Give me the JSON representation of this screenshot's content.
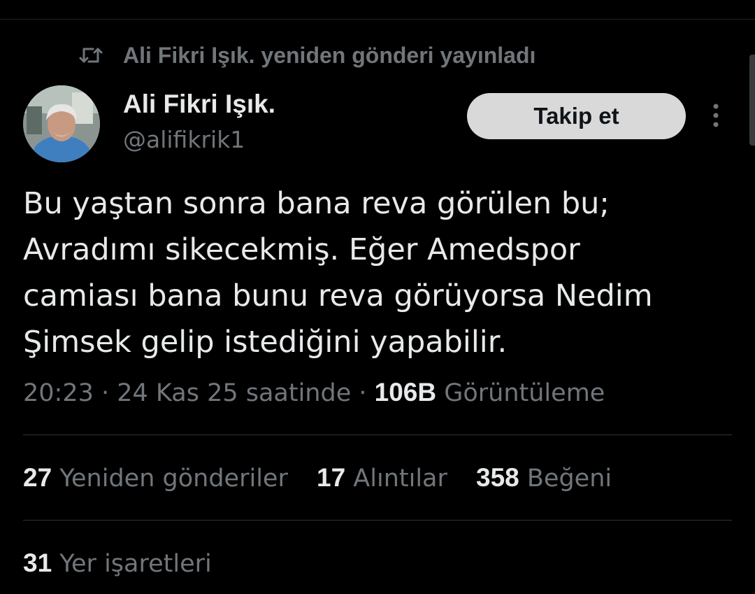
{
  "repost": {
    "icon": "repost-icon",
    "text": "Ali Fikri Işık. yeniden gönderi yayınladı"
  },
  "author": {
    "avatar": "avatar",
    "name": "Ali Fikri Işık.",
    "handle": "@alifikrik1"
  },
  "actions": {
    "follow_label": "Takip et",
    "more_icon": "more-vertical-icon"
  },
  "tweet": {
    "lines": [
      "Bu yaştan sonra bana reva görülen bu;",
      "Avradımı sikecekmiş. Eğer Amedspor",
      "camiası bana bunu reva görüyorsa Nedim",
      "Şimsek gelip istediğini yapabilir."
    ]
  },
  "meta": {
    "time": "20:23",
    "separator": " · ",
    "date": "24 Kas 25 saatinde",
    "views_count": "106B",
    "views_label": "Görüntüleme"
  },
  "stats": {
    "reposts_count": "27",
    "reposts_label": "Yeniden gönderiler",
    "quotes_count": "17",
    "quotes_label": "Alıntılar",
    "likes_count": "358",
    "likes_label": "Beğeni",
    "bookmarks_count": "31",
    "bookmarks_label": "Yer işaretleri"
  },
  "colors": {
    "background": "#000000",
    "primary_text": "#e7e9ea",
    "secondary_text": "#71767b",
    "follow_button_bg": "#d9d9d9",
    "divider": "#2f3336"
  }
}
